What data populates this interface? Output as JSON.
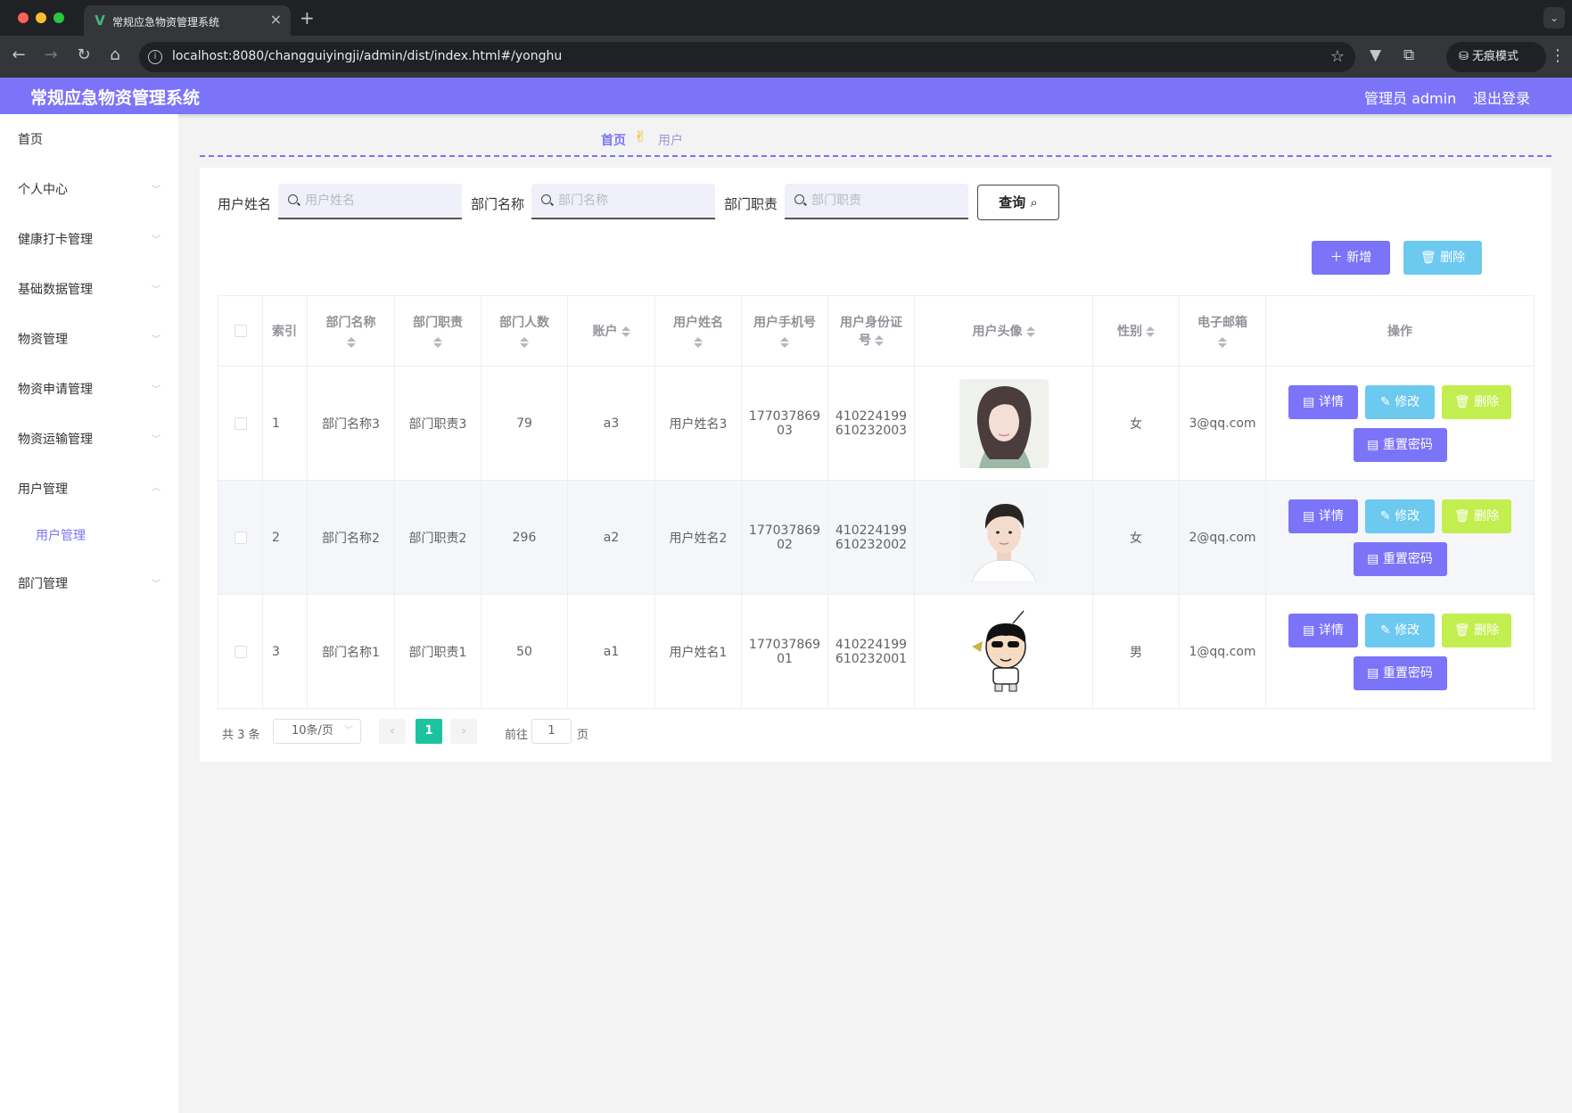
{
  "browser": {
    "tab_title": "常规应急物资管理系统",
    "url": "localhost:8080/changguiyingji/admin/dist/index.html#/yonghu",
    "incognito_label": "无痕模式"
  },
  "header": {
    "title": "常规应急物资管理系统",
    "user_label": "管理员 admin",
    "logout_label": "退出登录",
    "color": "#7b74f8"
  },
  "sidebar": {
    "items": [
      {
        "label": "首页"
      },
      {
        "label": "个人中心"
      },
      {
        "label": "健康打卡管理"
      },
      {
        "label": "基础数据管理"
      },
      {
        "label": "物资管理"
      },
      {
        "label": "物资申请管理"
      },
      {
        "label": "物资运输管理"
      },
      {
        "label": "用户管理"
      },
      {
        "label": "部门管理"
      }
    ],
    "sub_item": "用户管理"
  },
  "breadcrumb": {
    "home": "首页",
    "separator": "✌",
    "current": "用户"
  },
  "filters": {
    "name_label": "用户姓名",
    "name_placeholder": "用户姓名",
    "dept_label": "部门名称",
    "dept_placeholder": "部门名称",
    "duty_label": "部门职责",
    "duty_placeholder": "部门职责",
    "query_label": "查询"
  },
  "actions": {
    "add_label": "新增",
    "delete_label": "删除"
  },
  "table": {
    "headers": {
      "index": "索引",
      "dept_name": "部门名称",
      "dept_duty": "部门职责",
      "dept_count": "部门人数",
      "account": "账户",
      "user_name": "用户姓名",
      "phone": "用户手机号",
      "id_card_1": "用户身份证",
      "id_card_2": "号",
      "avatar": "用户头像",
      "gender": "性别",
      "email": "电子邮箱",
      "ops": "操作"
    },
    "row_buttons": {
      "detail": "详情",
      "edit": "修改",
      "delete": "删除",
      "reset": "重置密码"
    },
    "rows": [
      {
        "index": "1",
        "dept_name": "部门名称3",
        "dept_duty": "部门职责3",
        "dept_count": "79",
        "account": "a3",
        "user_name": "用户姓名3",
        "phone_1": "177037869",
        "phone_2": "03",
        "id_1": "410224199",
        "id_2": "610232003",
        "gender": "女",
        "email": "3@qq.com"
      },
      {
        "index": "2",
        "dept_name": "部门名称2",
        "dept_duty": "部门职责2",
        "dept_count": "296",
        "account": "a2",
        "user_name": "用户姓名2",
        "phone_1": "177037869",
        "phone_2": "02",
        "id_1": "410224199",
        "id_2": "610232002",
        "gender": "女",
        "email": "2@qq.com"
      },
      {
        "index": "3",
        "dept_name": "部门名称1",
        "dept_duty": "部门职责1",
        "dept_count": "50",
        "account": "a1",
        "user_name": "用户姓名1",
        "phone_1": "177037869",
        "phone_2": "01",
        "id_1": "410224199",
        "id_2": "610232001",
        "gender": "男",
        "email": "1@qq.com"
      }
    ]
  },
  "pagination": {
    "total": "共 3 条",
    "page_size": "10条/页",
    "current_page": "1",
    "goto_label": "前往",
    "goto_value": "1",
    "page_suffix": "页"
  }
}
